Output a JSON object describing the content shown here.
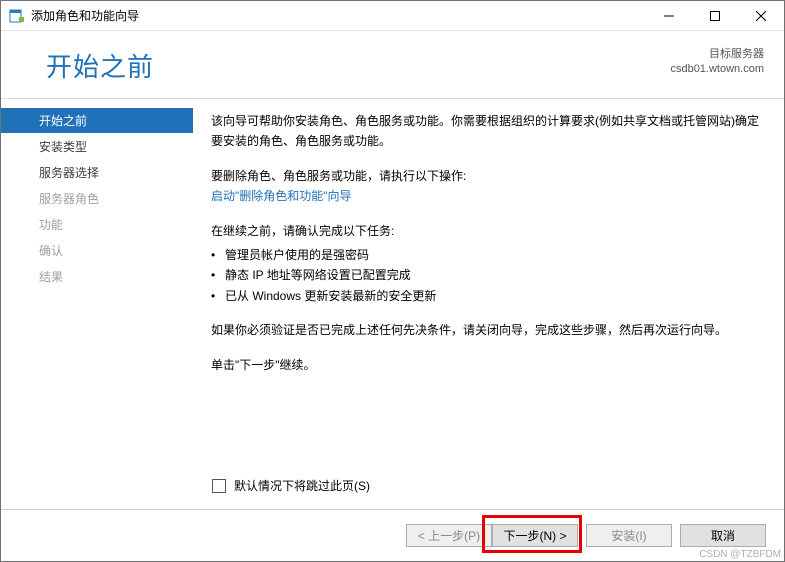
{
  "titlebar": {
    "title": "添加角色和功能向导"
  },
  "header": {
    "page_title": "开始之前",
    "dest_label": "目标服务器",
    "dest_server": "csdb01.wtown.com"
  },
  "sidebar": {
    "items": [
      {
        "label": "开始之前",
        "state": "active"
      },
      {
        "label": "安装类型",
        "state": "enabled"
      },
      {
        "label": "服务器选择",
        "state": "enabled"
      },
      {
        "label": "服务器角色",
        "state": "disabled"
      },
      {
        "label": "功能",
        "state": "disabled"
      },
      {
        "label": "确认",
        "state": "disabled"
      },
      {
        "label": "结果",
        "state": "disabled"
      }
    ]
  },
  "content": {
    "intro": "该向导可帮助你安装角色、角色服务或功能。你需要根据组织的计算要求(例如共享文档或托管网站)确定要安装的角色、角色服务或功能。",
    "remove_intro": "要删除角色、角色服务或功能，请执行以下操作:",
    "remove_link": "启动\"删除角色和功能\"向导",
    "confirm_intro": "在继续之前，请确认完成以下任务:",
    "bullets": [
      "管理员帐户使用的是强密码",
      "静态 IP 地址等网络设置已配置完成",
      "已从 Windows 更新安装最新的安全更新"
    ],
    "verify_text": "如果你必须验证是否已完成上述任何先决条件，请关闭向导，完成这些步骤，然后再次运行向导。",
    "continue_text": "单击\"下一步\"继续。",
    "skip_checkbox": "默认情况下将跳过此页(S)"
  },
  "footer": {
    "prev": "< 上一步(P)",
    "next": "下一步(N) >",
    "install": "安装(I)",
    "cancel": "取消"
  },
  "watermark": "CSDN @TZBFDM"
}
